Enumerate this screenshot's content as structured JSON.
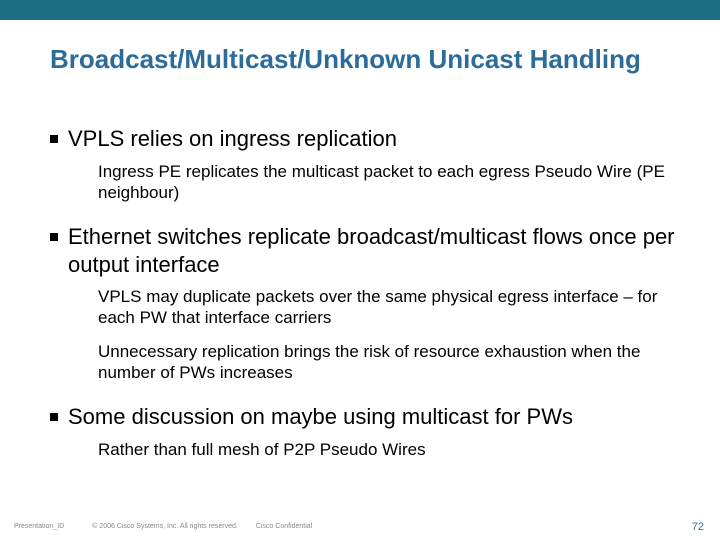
{
  "title": "Broadcast/Multicast/Unknown Unicast Handling",
  "bullets": [
    {
      "text": "VPLS relies on ingress replication",
      "subs": [
        "Ingress PE replicates the multicast packet to each egress Pseudo Wire (PE neighbour)"
      ]
    },
    {
      "text": "Ethernet switches replicate broadcast/multicast flows once per output interface",
      "subs": [
        "VPLS may duplicate packets over the same physical egress interface – for each PW that interface carriers",
        "Unnecessary replication brings the risk of resource exhaustion when the number of PWs increases"
      ]
    },
    {
      "text": "Some discussion on maybe using multicast for PWs",
      "subs": [
        "Rather than full mesh of P2P Pseudo Wires"
      ]
    }
  ],
  "footer": {
    "presentation_id": "Presentation_ID",
    "copyright": "© 2006 Cisco Systems, Inc. All rights reserved.",
    "confidential": "Cisco Confidential",
    "page": "72"
  }
}
